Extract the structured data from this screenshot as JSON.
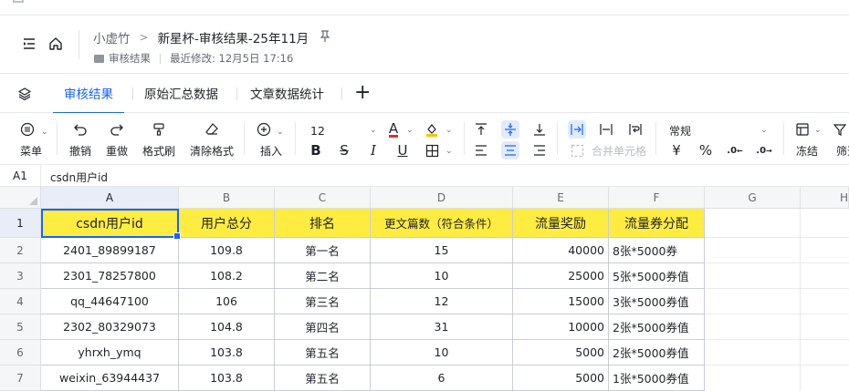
{
  "breadcrumb": {
    "parent": "小虚竹",
    "separator": ">",
    "document": "新星杯-审核结果-25年11月"
  },
  "meta": {
    "folder": "审核结果",
    "modified": "最近修改: 12月5日 17:16"
  },
  "tabs": [
    {
      "label": "审核结果",
      "active": true
    },
    {
      "label": "原始汇总数据",
      "active": false
    },
    {
      "label": "文章数据统计",
      "active": false
    }
  ],
  "tab_add": "+",
  "toolbar": {
    "menu": "菜单",
    "undo": "撤销",
    "redo": "重做",
    "format_painter": "格式刷",
    "clear_format": "清除格式",
    "insert": "插入",
    "font_size": "12",
    "merge_cells": "合并单元格",
    "number_format": "常规",
    "currency": "¥",
    "percent": "%",
    "freeze": "冻结",
    "filter": "筛选",
    "bold": "B",
    "strike": "S",
    "italic": "I",
    "underline": "U",
    "font_color_letter": "A",
    "decimal_inc": ".0",
    "decimal_dec": ".0"
  },
  "formula_bar": {
    "cell_ref": "A1",
    "value": "csdn用户id"
  },
  "grid": {
    "columns": [
      "A",
      "B",
      "C",
      "D",
      "E",
      "F",
      "G",
      "H"
    ],
    "row_numbers": [
      "1",
      "2",
      "3",
      "4",
      "5",
      "6",
      "7"
    ],
    "header": [
      "csdn用户id",
      "用户总分",
      "排名",
      "更文篇数（符合条件）",
      "流量奖励",
      "流量券分配"
    ],
    "rows": [
      [
        "2401_89899187",
        "109.8",
        "第一名",
        "15",
        "40000",
        "8张*5000券"
      ],
      [
        "2301_78257800",
        "108.2",
        "第二名",
        "10",
        "25000",
        "5张*5000券值"
      ],
      [
        "qq_44647100",
        "106",
        "第三名",
        "12",
        "15000",
        "3张*5000券值"
      ],
      [
        "2302_80329073",
        "104.8",
        "第四名",
        "31",
        "10000",
        "2张*5000券值"
      ],
      [
        "yhrxh_ymq",
        "103.8",
        "第五名",
        "10",
        "5000",
        "2张*5000券值"
      ],
      [
        "weixin_63944437",
        "103.8",
        "第五名",
        "6",
        "5000",
        "1张*5000券值"
      ]
    ],
    "header_fill": "#ffec40",
    "selection_color": "#1664ff"
  }
}
